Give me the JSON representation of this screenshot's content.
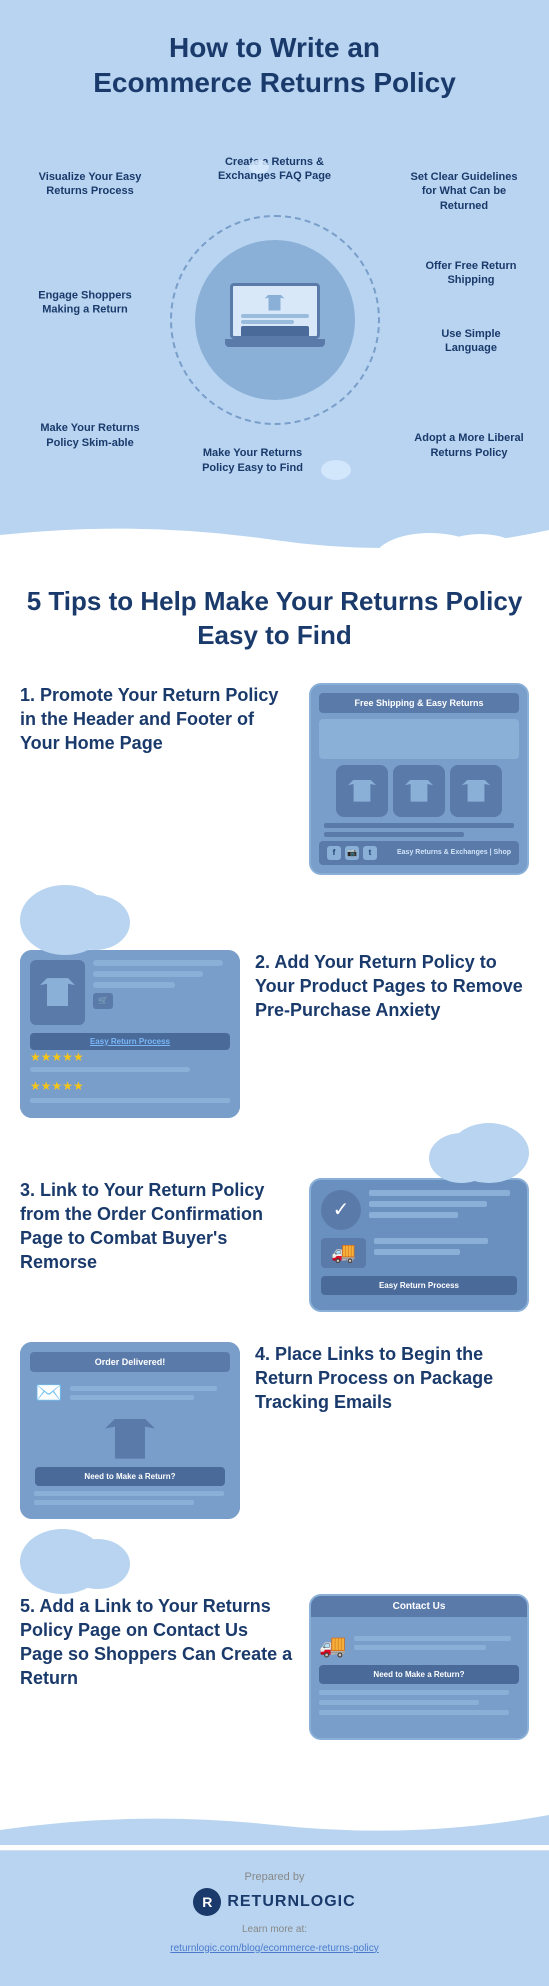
{
  "header": {
    "title_line1": "How to Write an",
    "title_line2": "Ecommerce Returns Policy"
  },
  "diagram": {
    "labels": {
      "tl": "Visualize Your Easy Returns Process",
      "tc": "Create a Returns & Exchanges FAQ Page",
      "tr": "Set Clear Guidelines for What Can be Returned",
      "ml": "Engage Shoppers Making a Return",
      "mr": "Offer Free Return Shipping",
      "mr2": "Use Simple Language",
      "bl": "Make Your Returns Policy Skim-able",
      "bml": "Make Your Returns Policy Easy to Find",
      "bmr": "Adopt a More Liberal Returns Policy"
    }
  },
  "tips_title": "5 Tips to Help Make Your Returns Policy Easy to Find",
  "tips": [
    {
      "number": "1.",
      "text": "Promote Your Return Policy in the Header and Footer of Your Home Page",
      "mock_top_bar": "Free Shipping & Easy Returns",
      "mock_footer_text": "Easy Returns & Exchanges | Shop"
    },
    {
      "number": "2.",
      "text": "Add Your Return Policy to Your Product Pages to Remove Pre-Purchase Anxiety",
      "mock_return_link": "Easy Return Process"
    },
    {
      "number": "3.",
      "text": "Link to Your Return Policy from the Order Confirmation Page to Combat Buyer's Remorse",
      "mock_btn": "Easy Return Process"
    },
    {
      "number": "4.",
      "text": "Place Links to Begin the Return Process on Package Tracking Emails",
      "mock_header": "Order Delivered!",
      "mock_btn": "Need to Make a Return?"
    },
    {
      "number": "5.",
      "text": "Add a Link to Your Returns Policy Page on Contact Us Page so Shoppers Can Create a Return",
      "mock_header": "Contact Us",
      "mock_btn": "Need to Make a Return?"
    }
  ],
  "footer": {
    "prepared_by": "Prepared by",
    "logo_letter": "R",
    "logo_name": "RETURNLOGIC",
    "learn_more": "Learn more at:",
    "link": "returnlogic.com/blog/ecommerce-returns-policy"
  }
}
